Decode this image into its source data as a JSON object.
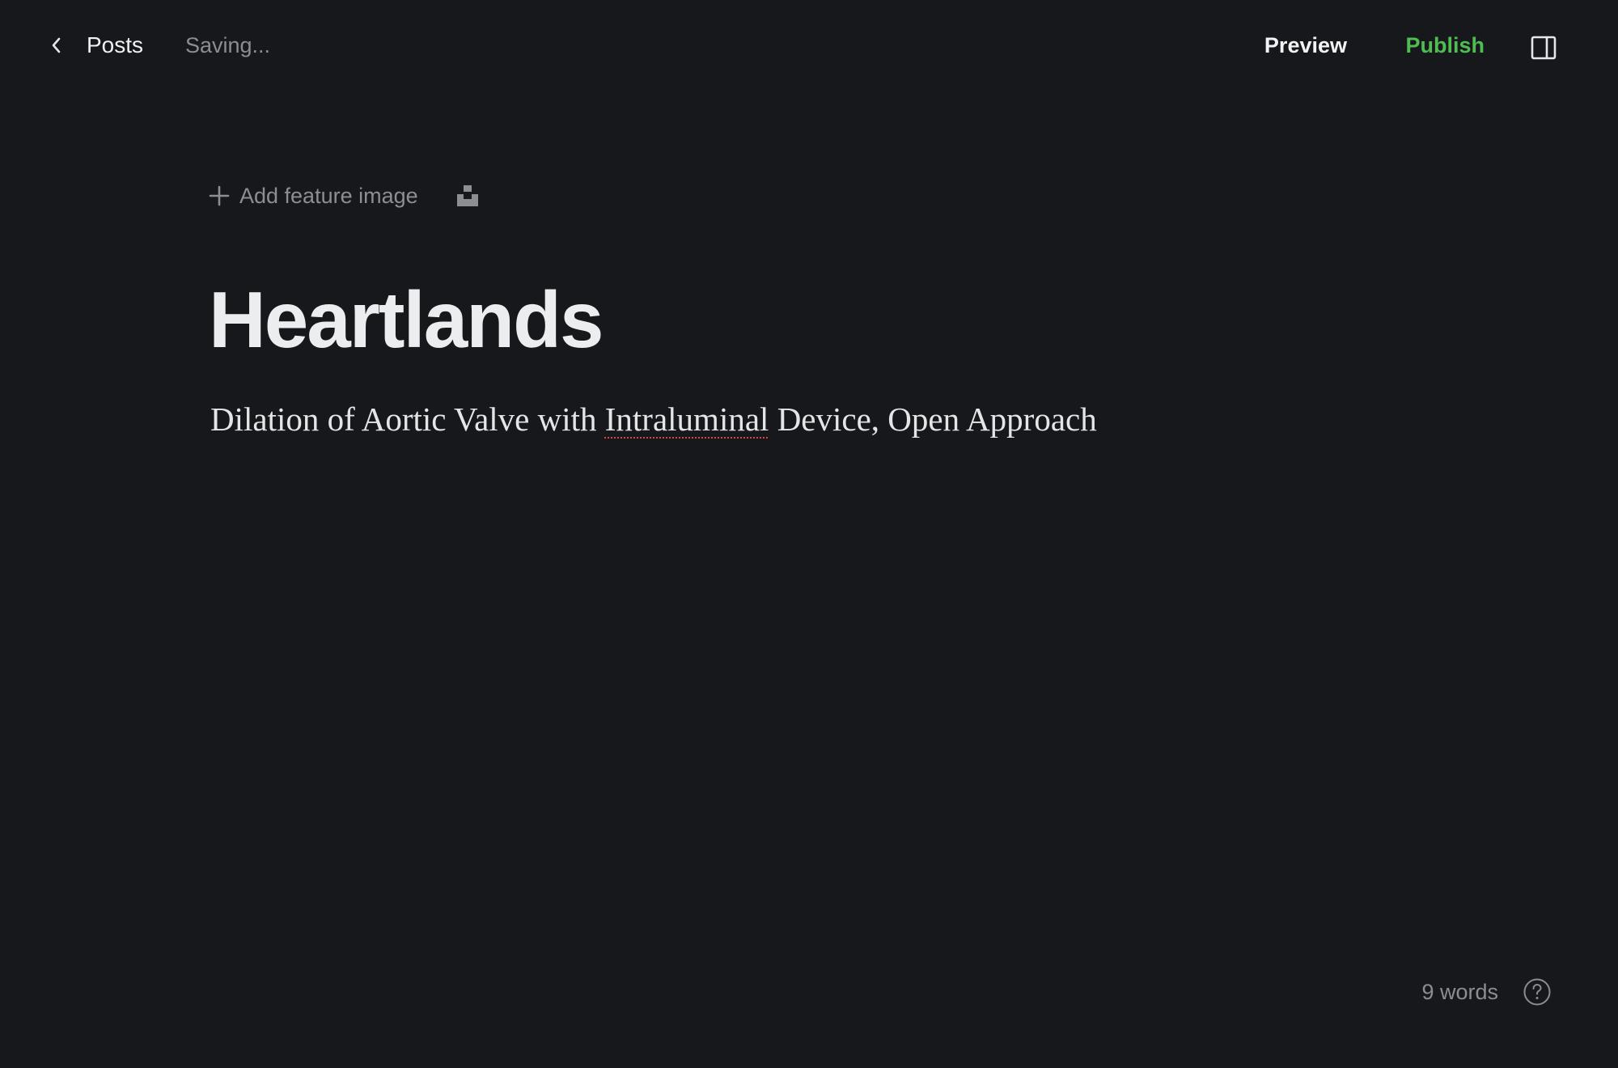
{
  "header": {
    "back_icon": "chevron-left-icon",
    "posts_label": "Posts",
    "status_text": "Saving...",
    "preview_label": "Preview",
    "publish_label": "Publish",
    "sidebar_toggle_icon": "sidebar-panel-icon"
  },
  "feature_image": {
    "add_label": "Add feature image",
    "plus_icon": "plus-icon",
    "unsplash_icon": "unsplash-icon"
  },
  "editor": {
    "title": "Heartlands",
    "body_before": "Dilation of Aortic Valve with ",
    "body_misspelled": "Intraluminal",
    "body_after": " Device, Open Approach"
  },
  "footer": {
    "word_count": "9 words",
    "help_icon": "help-icon"
  },
  "colors": {
    "background": "#16181c",
    "publish_accent": "#4fbd4f",
    "muted_text": "#8a8d92",
    "spellcheck_underline": "#d14646"
  }
}
